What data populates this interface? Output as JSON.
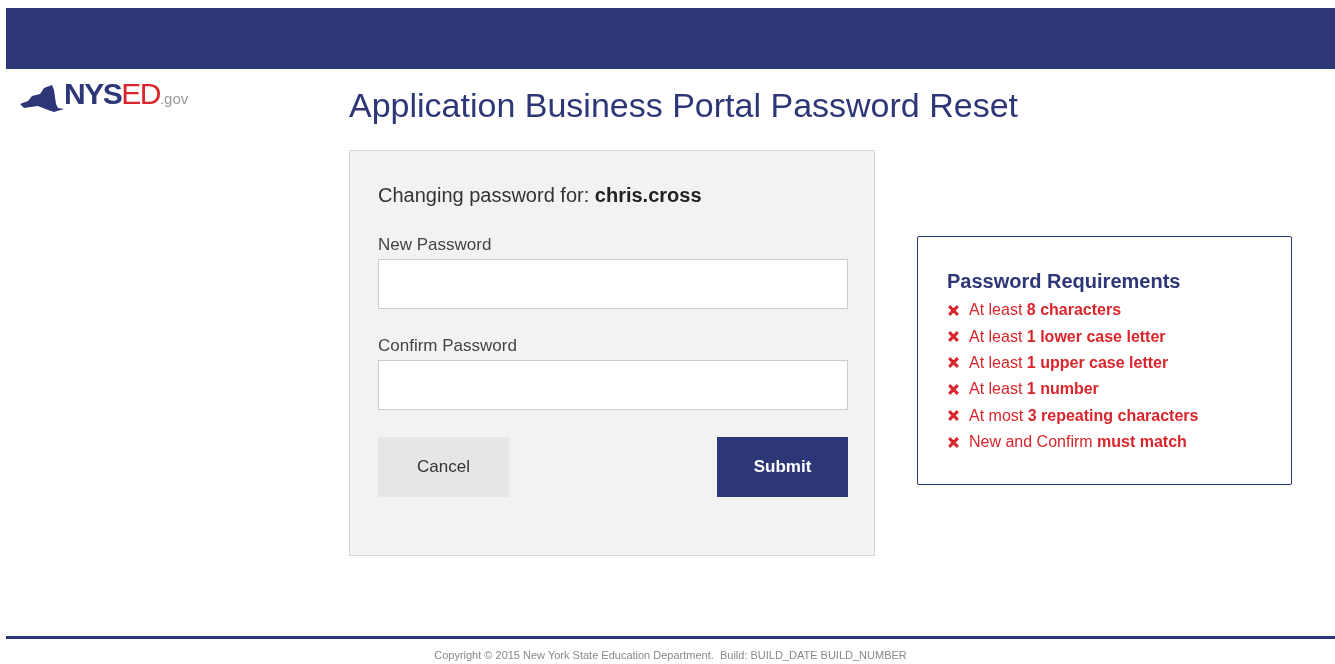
{
  "logo": {
    "state_text": "NYS",
    "ed_text": "ED",
    "suffix": ".gov"
  },
  "title": "Application Business Portal Password Reset",
  "form": {
    "changing_label": "Changing password for:",
    "username": "chris.cross",
    "fields": [
      {
        "label": "New Password"
      },
      {
        "label": "Confirm Password"
      }
    ],
    "cancel": "Cancel",
    "submit": "Submit"
  },
  "requirements": {
    "title": "Password Requirements",
    "items": [
      {
        "text": "At least **8 characters**",
        "met": false
      },
      {
        "text": "At least **1 lower case letter**",
        "met": false
      },
      {
        "text": "At least **1 upper case letter**",
        "met": false
      },
      {
        "text": "At least **1 number**",
        "met": false
      },
      {
        "text": "At most **3 repeating characters**",
        "met": false
      },
      {
        "text": "New and Confirm **must match**",
        "met": false
      }
    ]
  },
  "footer": "Copyright © 2015 New York State Education Department.  Build: BUILD_DATE BUILD_NUMBER"
}
